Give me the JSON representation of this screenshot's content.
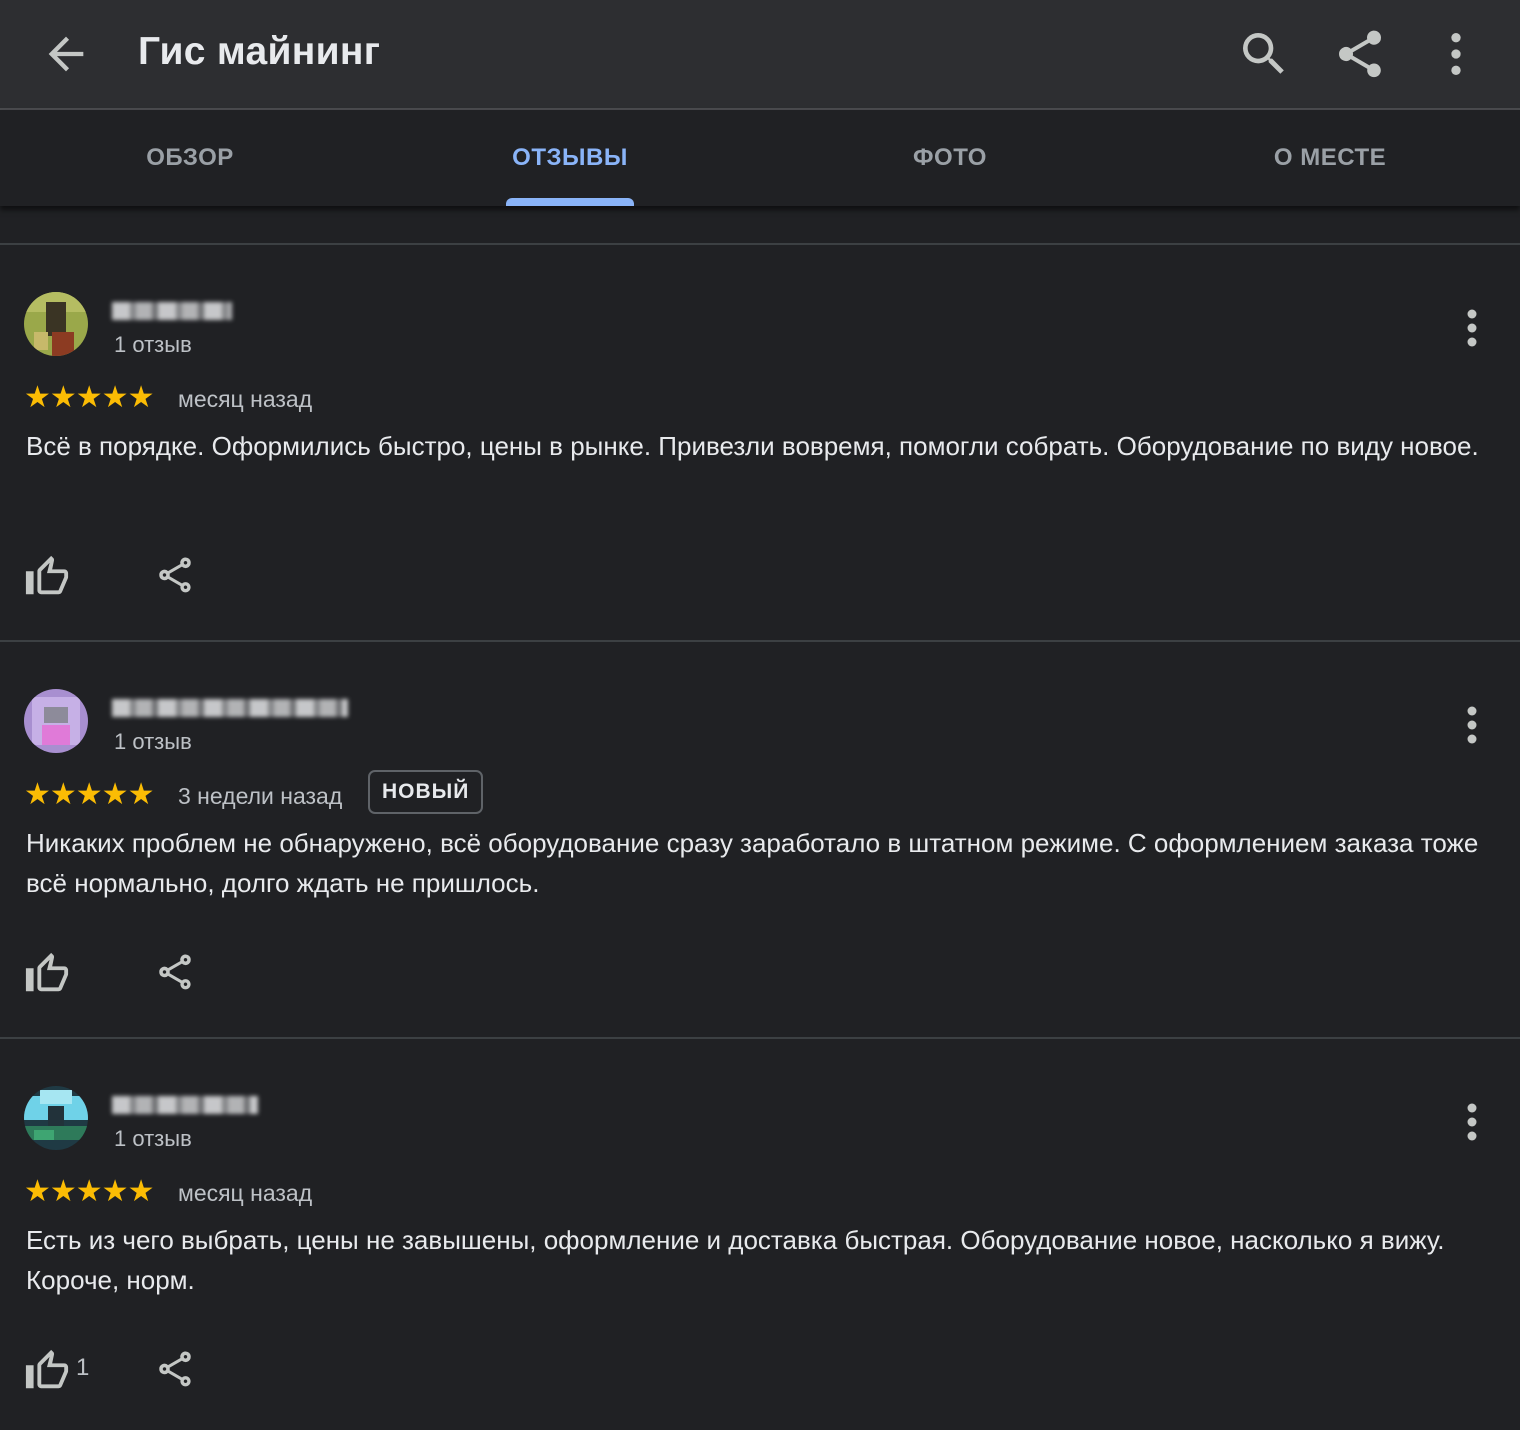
{
  "header": {
    "title": "Гис майнинг",
    "icons": [
      "arrow-back-icon",
      "search-icon",
      "share-icon",
      "more-vert-icon"
    ]
  },
  "tabs": [
    {
      "label": "ОБЗОР",
      "active": false
    },
    {
      "label": "ОТЗЫВЫ",
      "active": true
    },
    {
      "label": "ФОТО",
      "active": false
    },
    {
      "label": "О МЕСТЕ",
      "active": false
    }
  ],
  "reviews": [
    {
      "reviewer_count": "1 отзыв",
      "stars": "★★★★★",
      "rating": 5,
      "time": "месяц назад",
      "text": "Всё в порядке. Оформились быстро, цены в рынке. Привезли вовремя, помогли собрать. Оборудование по виду новое.",
      "likes": ""
    },
    {
      "reviewer_count": "1 отзыв",
      "stars": "★★★★★",
      "rating": 5,
      "time": "3 недели назад",
      "badge": "НОВЫЙ",
      "text": "Никаких проблем не обнаружено, всё оборудование сразу заработало в штатном режиме. С оформлением заказа тоже всё нормально, долго ждать не пришлось.",
      "likes": ""
    },
    {
      "reviewer_count": "1 отзыв",
      "stars": "★★★★★",
      "rating": 5,
      "time": "месяц назад",
      "text": "Есть из чего выбрать, цены не завышены, оформление и доставка быстрая. Оборудование новое, насколько я вижу. Короче, норм.",
      "likes": "1"
    }
  ],
  "colors": {
    "background": "#202124",
    "appbar": "#2d2e31",
    "accent": "#8ab4f8",
    "star": "#fbbc04",
    "text_secondary": "#bdc1c6"
  }
}
